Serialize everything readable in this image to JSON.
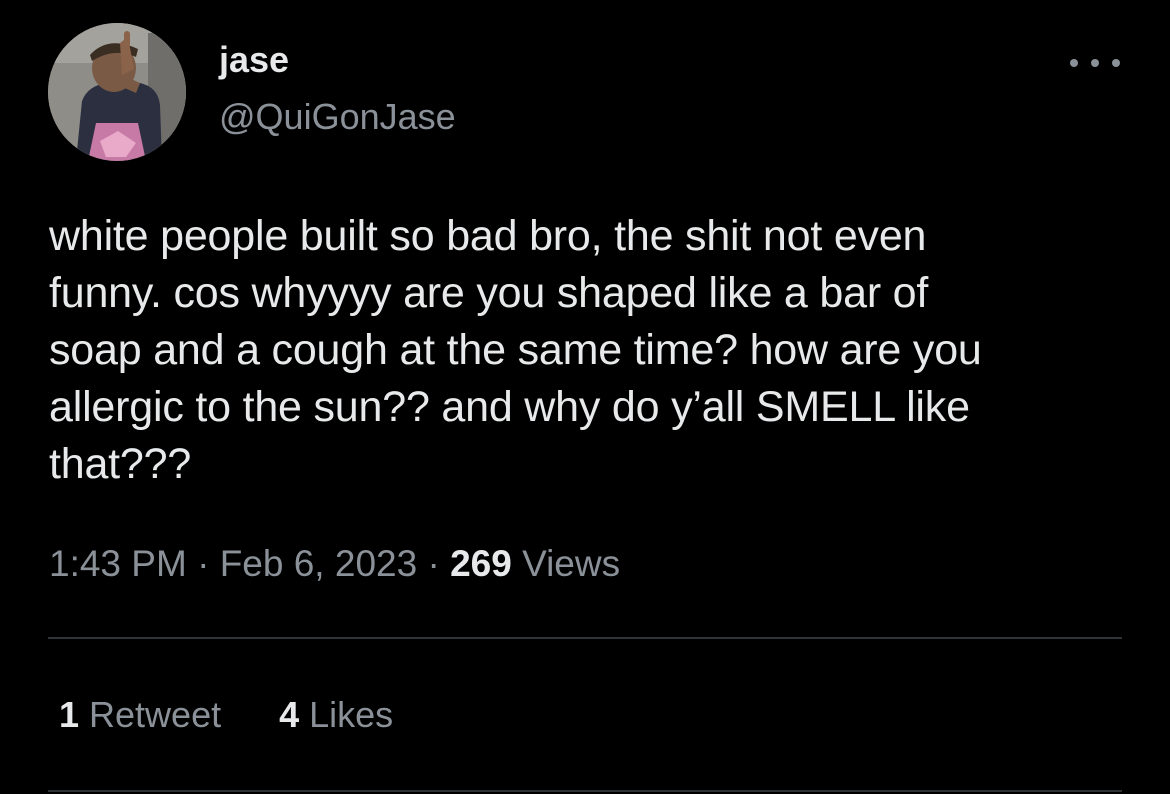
{
  "author": {
    "display_name": "jase",
    "handle": "@QuiGonJase",
    "avatar_icon": "profile-photo"
  },
  "tweet": {
    "text": "white people built so bad bro, the shit not even\nfunny. cos whyyyy are you shaped like a bar of\nsoap and a cough at the same time? how are you\nallergic to the sun?? and why do y’all SMELL like\nthat???",
    "time": "1:43 PM",
    "separator": " · ",
    "date": "Feb 6, 2023",
    "views_count": "269",
    "views_label": " Views"
  },
  "stats": {
    "retweets_count": "1",
    "retweets_label": " Retweet",
    "likes_count": "4",
    "likes_label": " Likes"
  },
  "menu": {
    "icon": "more-horizontal-icon"
  },
  "colors": {
    "background": "#000000",
    "primary_text": "#e7e9ea",
    "secondary_text": "#8b9198",
    "divider": "#2f3336"
  }
}
